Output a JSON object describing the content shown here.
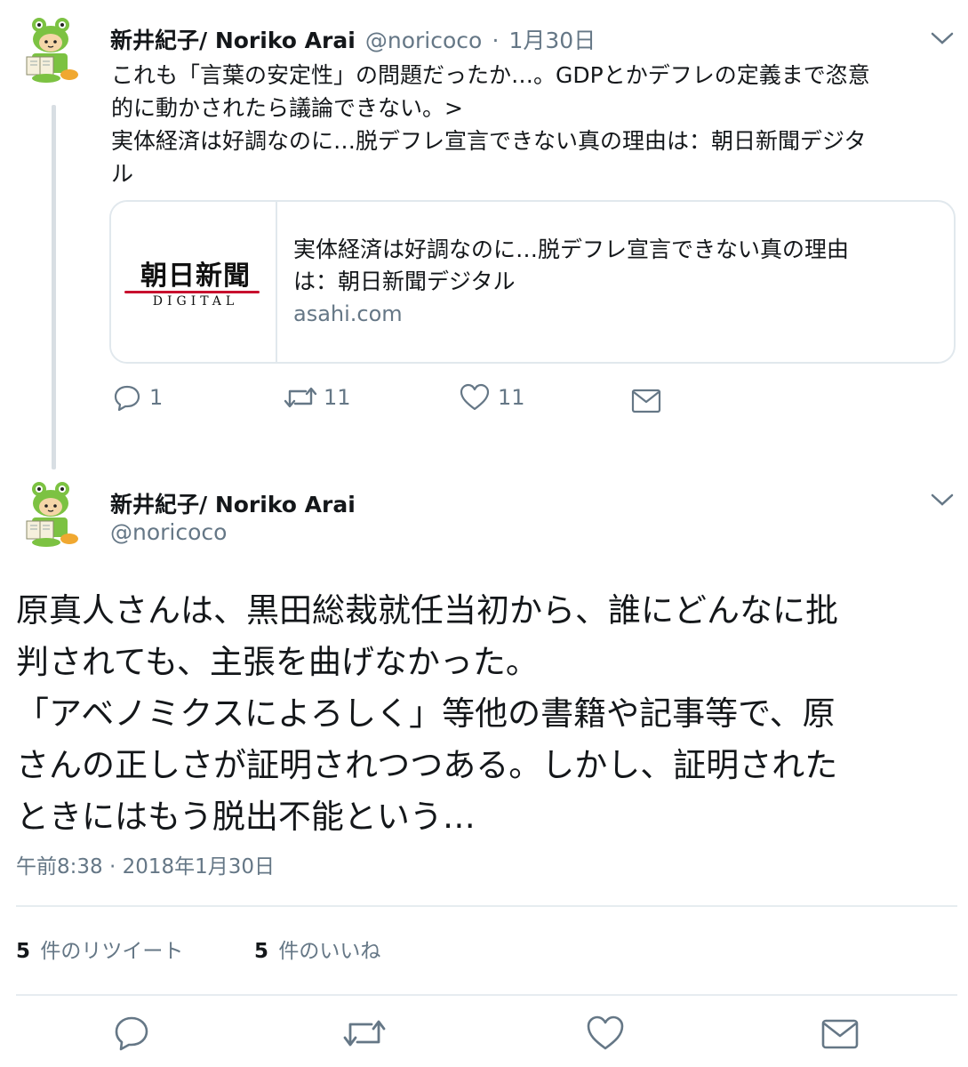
{
  "tweet1": {
    "name": "新井紀子/ Noriko Arai",
    "handle": "@noricoco",
    "separator": "·",
    "date": "1月30日",
    "text_lines": [
      "これも「言葉の安定性」の問題だったか…。GDPとかデフレの定義まで恣意",
      "的に動かされたら議論できない。>",
      "実体経済は好調なのに…脱デフレ宣言できない真の理由は：朝日新聞デジタ",
      "ル"
    ],
    "card": {
      "logo_kanji": "朝日新聞",
      "logo_sub": "DIGITAL",
      "title_lines": [
        "実体経済は好調なのに…脱デフレ宣言できない真の理由",
        "は：朝日新聞デジタル"
      ],
      "domain": "asahi.com"
    },
    "actions": {
      "reply_count": "1",
      "retweet_count": "11",
      "like_count": "11"
    }
  },
  "tweet2": {
    "name": "新井紀子/ Noriko Arai",
    "handle": "@noricoco",
    "text_lines": [
      "原真人さんは、黒田総裁就任当初から、誰にどんなに批",
      "判されても、主張を曲げなかった。",
      "「アベノミクスによろしく」等他の書籍や記事等で、原",
      "さんの正しさが証明されつつある。しかし、証明された",
      "ときにはもう脱出不能という…"
    ],
    "timestamp": "午前8:38 · 2018年1月30日",
    "retweets": {
      "count": "5",
      "unit": "件の",
      "label": "リツイート"
    },
    "likes": {
      "count": "5",
      "unit": "件の",
      "label": "いいね"
    }
  },
  "icons": [
    "frog-avatar-icon",
    "chevron-down-icon",
    "reply-icon",
    "retweet-icon",
    "like-icon",
    "dm-icon"
  ],
  "colors": {
    "text": "#14171a",
    "secondary": "#657786",
    "border": "#e1e8ed",
    "logo_red": "#c8102e",
    "avatar_green": "#7cc242"
  }
}
